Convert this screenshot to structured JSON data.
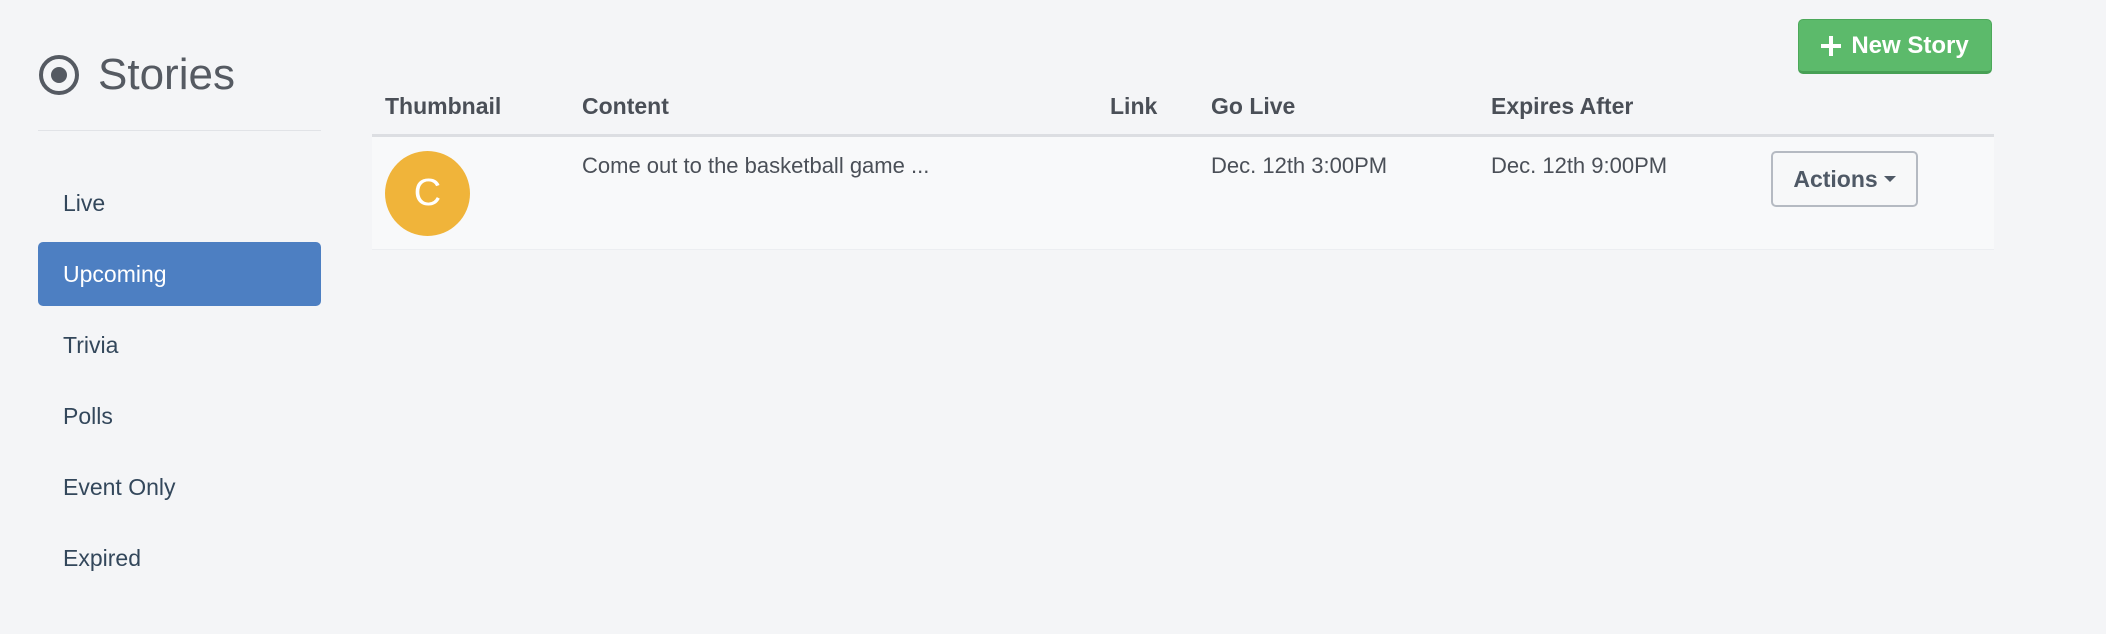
{
  "sidebar": {
    "title": "Stories",
    "icon": "radio-target-icon",
    "items": [
      {
        "label": "Live",
        "active": false
      },
      {
        "label": "Upcoming",
        "active": true
      },
      {
        "label": "Trivia",
        "active": false
      },
      {
        "label": "Polls",
        "active": false
      },
      {
        "label": "Event Only",
        "active": false
      },
      {
        "label": "Expired",
        "active": false
      }
    ]
  },
  "toolbar": {
    "new_story_label": "New Story",
    "new_story_icon": "plus-icon"
  },
  "table": {
    "columns": [
      "Thumbnail",
      "Content",
      "Link",
      "Go Live",
      "Expires After"
    ],
    "rows": [
      {
        "thumbnail_letter": "C",
        "content": "Come out to the basketball game ...",
        "link": "",
        "go_live": "Dec. 12th 3:00PM",
        "expires_after": "Dec. 12th 9:00PM",
        "actions_label": "Actions"
      }
    ]
  },
  "colors": {
    "accent": "#4d7fc2",
    "success": "#5cba6b",
    "thumbnail": "#f0b43a",
    "background": "#f4f5f7"
  }
}
